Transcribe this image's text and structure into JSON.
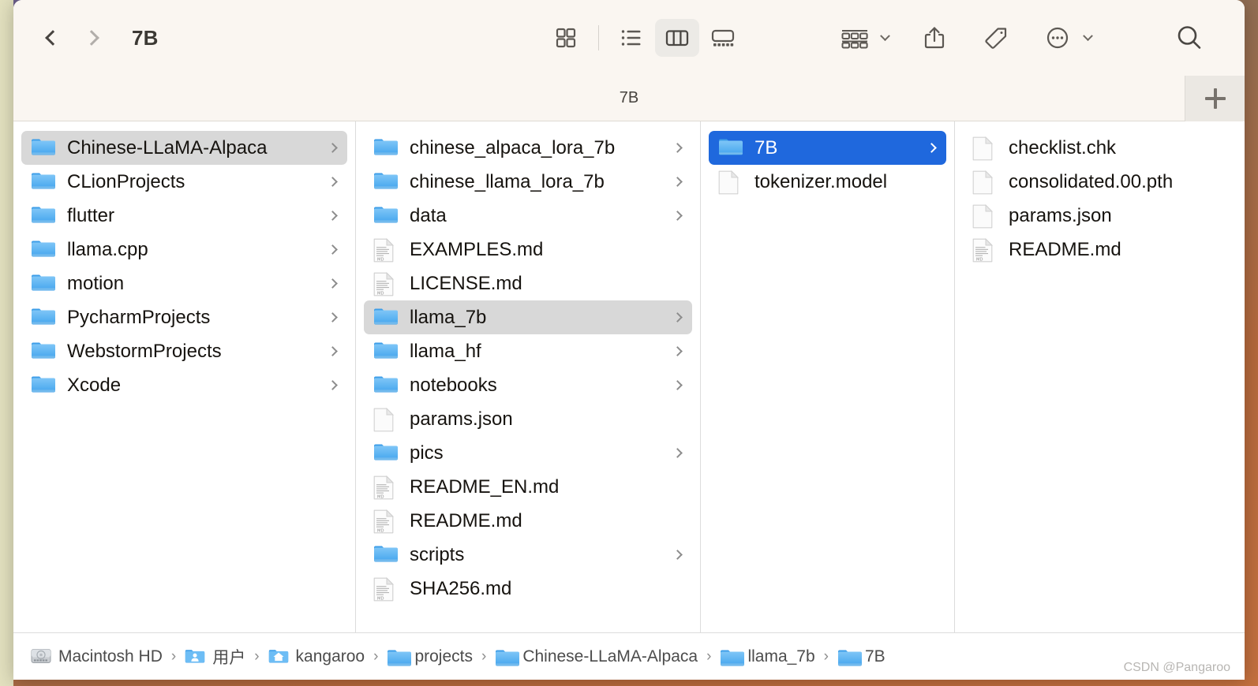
{
  "window": {
    "title": "7B",
    "tab_title": "7B",
    "new_tab_label": "+",
    "accent_blue": "#1f68dd",
    "toolbar_bg": "#faf6f1",
    "selection_gray": "#d8d8d8"
  },
  "toolbar": {
    "back_label": "Back",
    "forward_label": "Forward",
    "icon_view_label": "Icon View",
    "list_view_label": "List View",
    "column_view_label": "Column View",
    "gallery_view_label": "Gallery View",
    "group_label": "Group",
    "share_label": "Share",
    "tags_label": "Tags",
    "more_label": "More",
    "search_label": "Search",
    "active_view": "column"
  },
  "columns": [
    {
      "name": "column-1",
      "items": [
        {
          "label": "Chinese-LLaMA-Alpaca",
          "icon": "folder-icon",
          "chevron": true,
          "selected": "gray"
        },
        {
          "label": "CLionProjects",
          "icon": "folder-icon",
          "chevron": true,
          "selected": "none"
        },
        {
          "label": "flutter",
          "icon": "folder-icon",
          "chevron": true,
          "selected": "none"
        },
        {
          "label": "llama.cpp",
          "icon": "folder-icon",
          "chevron": true,
          "selected": "none"
        },
        {
          "label": "motion",
          "icon": "folder-icon",
          "chevron": true,
          "selected": "none"
        },
        {
          "label": "PycharmProjects",
          "icon": "folder-icon",
          "chevron": true,
          "selected": "none"
        },
        {
          "label": "WebstormProjects",
          "icon": "folder-icon",
          "chevron": true,
          "selected": "none"
        },
        {
          "label": "Xcode",
          "icon": "folder-icon",
          "chevron": true,
          "selected": "none"
        }
      ]
    },
    {
      "name": "column-2",
      "items": [
        {
          "label": "chinese_alpaca_lora_7b",
          "icon": "folder-icon",
          "chevron": true,
          "selected": "none"
        },
        {
          "label": "chinese_llama_lora_7b",
          "icon": "folder-icon",
          "chevron": true,
          "selected": "none"
        },
        {
          "label": "data",
          "icon": "folder-icon",
          "chevron": true,
          "selected": "none"
        },
        {
          "label": "EXAMPLES.md",
          "icon": "markdown-file-icon",
          "chevron": false,
          "selected": "none"
        },
        {
          "label": "LICENSE.md",
          "icon": "markdown-file-icon",
          "chevron": false,
          "selected": "none"
        },
        {
          "label": "llama_7b",
          "icon": "folder-icon",
          "chevron": true,
          "selected": "gray"
        },
        {
          "label": "llama_hf",
          "icon": "folder-icon",
          "chevron": true,
          "selected": "none"
        },
        {
          "label": "notebooks",
          "icon": "folder-icon",
          "chevron": true,
          "selected": "none"
        },
        {
          "label": "params.json",
          "icon": "blank-file-icon",
          "chevron": false,
          "selected": "none"
        },
        {
          "label": "pics",
          "icon": "folder-icon",
          "chevron": true,
          "selected": "none"
        },
        {
          "label": "README_EN.md",
          "icon": "markdown-file-icon",
          "chevron": false,
          "selected": "none"
        },
        {
          "label": "README.md",
          "icon": "markdown-file-icon",
          "chevron": false,
          "selected": "none"
        },
        {
          "label": "scripts",
          "icon": "folder-icon",
          "chevron": true,
          "selected": "none"
        },
        {
          "label": "SHA256.md",
          "icon": "markdown-file-icon",
          "chevron": false,
          "selected": "none"
        }
      ]
    },
    {
      "name": "column-3",
      "items": [
        {
          "label": "7B",
          "icon": "folder-icon",
          "chevron": true,
          "selected": "blue"
        },
        {
          "label": "tokenizer.model",
          "icon": "blank-file-icon",
          "chevron": false,
          "selected": "none"
        }
      ]
    },
    {
      "name": "column-4",
      "items": [
        {
          "label": "checklist.chk",
          "icon": "blank-file-icon",
          "chevron": false,
          "selected": "none"
        },
        {
          "label": "consolidated.00.pth",
          "icon": "blank-file-icon",
          "chevron": false,
          "selected": "none"
        },
        {
          "label": "params.json",
          "icon": "blank-file-icon",
          "chevron": false,
          "selected": "none"
        },
        {
          "label": "README.md",
          "icon": "markdown-file-icon",
          "chevron": false,
          "selected": "none"
        }
      ]
    }
  ],
  "pathbar": {
    "separator": "›",
    "crumbs": [
      {
        "label": "Macintosh HD",
        "icon": "harddisk-icon"
      },
      {
        "label": "用户",
        "icon": "users-folder-icon"
      },
      {
        "label": "kangaroo",
        "icon": "home-folder-icon"
      },
      {
        "label": "projects",
        "icon": "folder-icon"
      },
      {
        "label": "Chinese-LLaMA-Alpaca",
        "icon": "folder-icon"
      },
      {
        "label": "llama_7b",
        "icon": "folder-icon"
      },
      {
        "label": "7B",
        "icon": "folder-icon"
      }
    ]
  },
  "watermark": "CSDN @Pangaroo"
}
